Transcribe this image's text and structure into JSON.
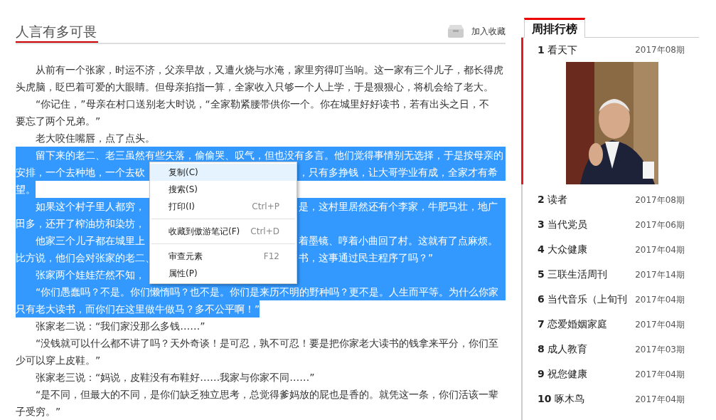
{
  "article": {
    "title": "人言有多可畏",
    "bookmark": "加入收藏",
    "paragraphs": [
      {
        "lines": [
          {
            "text": "从前有一个张家，时运不济，父亲早故，又遭火烧与水淹，家里穷得叮当响。这一家有三个儿子，都长得虎",
            "selected": false
          },
          {
            "text": "头虎脑，眨巴着可爱的大眼睛。但母亲掐指一算，全家收入只够一个人上学，于是狠狠心，将机会给了老大。",
            "selected": false
          }
        ]
      },
      {
        "lines": [
          {
            "text": "“你记住，”母亲在村口送别老大时说，“全家勒紧腰带供你一个。你在城里好好读书，若有出头之日，不",
            "selected": false
          },
          {
            "text": "要忘了两个兄弟。”",
            "selected": false
          }
        ]
      },
      {
        "lines": [
          {
            "text": "老大咬住嘴唇，点了点头。",
            "selected": false
          }
        ]
      },
      {
        "lines": [
          {
            "text": "留下来的老二、老三虽然有些失落，偷偷哭、叹气，但也没有多言。他们觉得事情别无选择，于是按母亲的",
            "selected": true
          },
          {
            "left": "安排，一个去种地，一个去砍",
            "right": "，只有多挣钱，让大哥学业有成，全家才有希",
            "selected": true
          },
          {
            "text": "望。",
            "selected": true
          }
        ]
      },
      {
        "lines": [
          {
            "left": "如果这个村子里人都穷，",
            "right": "是，这村里居然还有个李家，牛肥马壮，地广",
            "selected": true
          },
          {
            "left": "田多，还开了榨油坊和染坊，",
            "selected": true
          }
        ]
      },
      {
        "lines": [
          {
            "left": "他家三个儿子都在城里上",
            "right": "着墨镜、哼着小曲回了村。这就有了点麻烦。",
            "selected": true
          },
          {
            "left": "比方说，他们会对张家的老二、",
            "right": "书，这事通过民主程序了吗？”",
            "selected": true
          }
        ]
      },
      {
        "lines": [
          {
            "left": "张家两个娃娃茫然不知，",
            "selected": true
          }
        ]
      },
      {
        "lines": [
          {
            "text": "“你们愚蠢吗？不是。你们懒惰吗？也不是。你们是来历不明的野种吗？更不是。人生而平等。为什么你家",
            "selected": true
          },
          {
            "text": "只有老大读书，而你们在这里做牛做马？多不公平啊！”",
            "selected": true
          }
        ]
      },
      {
        "lines": [
          {
            "text": "张家老二说：“我们家没那么多钱……”",
            "selected": false
          }
        ]
      },
      {
        "lines": [
          {
            "text": "“没钱就可以什么都不讲了吗？天外奇谈！是可忍，孰不可忍！要是把你家老大读书的钱拿来平分，你们至",
            "selected": false
          },
          {
            "text": "少可以穿上皮鞋。”",
            "selected": false
          }
        ]
      },
      {
        "lines": [
          {
            "text": "张家老三说：“妈说，皮鞋没有布鞋好……我家与你家不同……”",
            "selected": false
          }
        ]
      },
      {
        "lines": [
          {
            "text": "“是不同，但最大的不同，是你们缺乏独立思考，总觉得爹妈放的屁也是香的。就凭这一条，你们活该一辈",
            "selected": false
          },
          {
            "text": "子受穷。”",
            "selected": false
          }
        ]
      }
    ]
  },
  "context_menu": {
    "items": [
      {
        "kind": "item",
        "label": "复制(C)",
        "hovered": true
      },
      {
        "kind": "item",
        "label": "搜索(S)",
        "hovered": false
      },
      {
        "kind": "item",
        "label": "打印(I)",
        "shortcut": "Ctrl+P",
        "hovered": false
      },
      {
        "kind": "separator"
      },
      {
        "kind": "item",
        "label": "收藏到傲游笔记(F)",
        "shortcut": "Ctrl+D",
        "hovered": false
      },
      {
        "kind": "separator"
      },
      {
        "kind": "item",
        "label": "审查元素",
        "shortcut": "F12",
        "hovered": false
      },
      {
        "kind": "item",
        "label": "属性(P)",
        "hovered": false
      }
    ]
  },
  "ranking": {
    "tab": "周排行榜",
    "items": [
      {
        "rank": "1",
        "title": "看天下",
        "issue": "2017年08期",
        "expanded": true
      },
      {
        "rank": "2",
        "title": "读者",
        "issue": "2017年08期",
        "expanded": false
      },
      {
        "rank": "3",
        "title": "当代党员",
        "issue": "2017年06期",
        "expanded": false
      },
      {
        "rank": "4",
        "title": "大众健康",
        "issue": "2017年04期",
        "expanded": false
      },
      {
        "rank": "5",
        "title": "三联生活周刊",
        "issue": "2017年14期",
        "expanded": false
      },
      {
        "rank": "6",
        "title": "当代音乐（上旬刊",
        "issue": "2017年04期",
        "expanded": false
      },
      {
        "rank": "7",
        "title": "恋爱婚姻家庭",
        "issue": "2017年04期",
        "expanded": false
      },
      {
        "rank": "8",
        "title": "成人教育",
        "issue": "2017年03期",
        "expanded": false
      },
      {
        "rank": "9",
        "title": "祝您健康",
        "issue": "2017年04期",
        "expanded": false
      },
      {
        "rank": "10",
        "title": "啄木鸟",
        "issue": "2017年04期",
        "expanded": false
      }
    ]
  }
}
